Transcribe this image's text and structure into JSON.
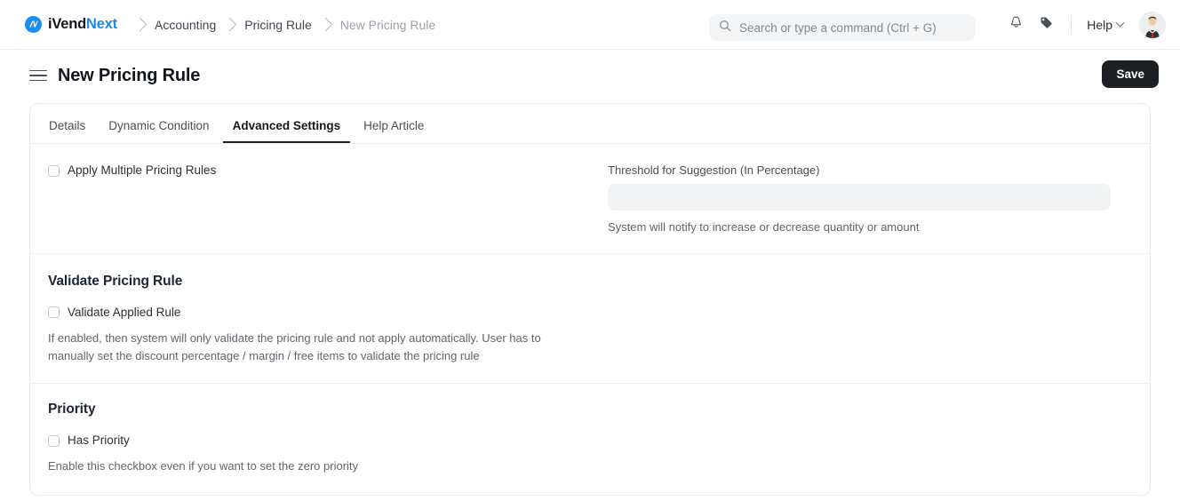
{
  "navbar": {
    "brand": {
      "name_primary": "iVend",
      "name_accent": "Next",
      "logo_icon": "ivend-logo-icon"
    },
    "breadcrumb": [
      {
        "label": "Accounting",
        "muted": false
      },
      {
        "label": "Pricing Rule",
        "muted": false
      },
      {
        "label": "New Pricing Rule",
        "muted": true
      }
    ],
    "search": {
      "placeholder": "Search or type a command (Ctrl + G)",
      "value": "",
      "icon": "search-icon"
    },
    "notifications_icon": "bell-icon",
    "tag_icon": "tag-icon",
    "help": {
      "label": "Help",
      "chevron_icon": "chevron-down-icon"
    },
    "avatar_icon": "user-avatar"
  },
  "page": {
    "menu_icon": "hamburger-menu-icon",
    "title": "New Pricing Rule",
    "save_label": "Save"
  },
  "tabs": [
    {
      "label": "Details",
      "active": false
    },
    {
      "label": "Dynamic Condition",
      "active": false
    },
    {
      "label": "Advanced Settings",
      "active": true
    },
    {
      "label": "Help Article",
      "active": false
    }
  ],
  "sections": {
    "apply_rules": {
      "checkbox_label": "Apply Multiple Pricing Rules",
      "checked": false,
      "threshold_label": "Threshold for Suggestion (In Percentage)",
      "threshold_value": "",
      "threshold_placeholder": "",
      "threshold_help": "System will notify to increase or decrease quantity or amount"
    },
    "validate": {
      "title": "Validate Pricing Rule",
      "checkbox_label": "Validate Applied Rule",
      "checked": false,
      "description": "If enabled, then system will only validate the pricing rule and not apply automatically. User has to manually set the discount percentage / margin / free items to validate the pricing rule"
    },
    "priority": {
      "title": "Priority",
      "checkbox_label": "Has Priority",
      "checked": false,
      "description": "Enable this checkbox even if you want to set the zero priority"
    }
  },
  "colors": {
    "accent": "#1a8cf0",
    "dark": "#1d2024",
    "text": "#13171c",
    "muted": "#5f666e",
    "border": "#ececec",
    "field_bg": "#f2f3f4"
  }
}
